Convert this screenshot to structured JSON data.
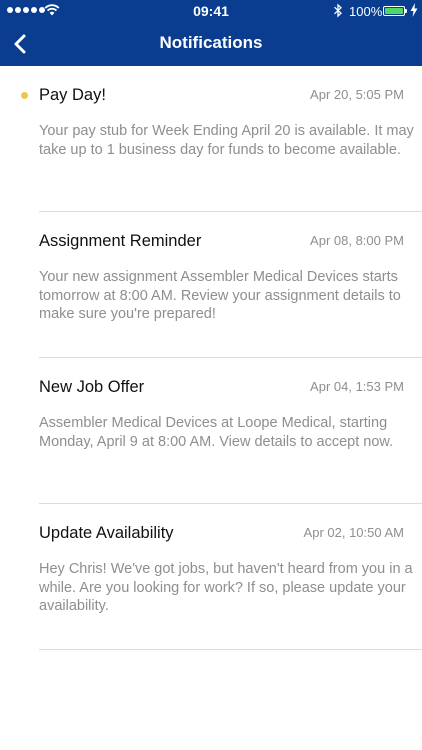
{
  "status_bar": {
    "time": "09:41",
    "battery_percent": "100%",
    "battery_level": 1.0,
    "icons": [
      "signal-dots",
      "wifi-icon",
      "bluetooth-icon",
      "battery-icon",
      "charging-bolt-icon"
    ]
  },
  "nav": {
    "title": "Notifications",
    "back_icon": "chevron-left-icon"
  },
  "colors": {
    "header_bg": "#0a3d8f",
    "unread_dot": "#f3c544",
    "battery_fill": "#4cd964",
    "body_text": "#8e8e93"
  },
  "notifications": [
    {
      "title": "Pay Day!",
      "date": "Apr 20, 5:05 PM",
      "body": "Your pay stub for Week Ending April 20 is available. It may take up to 1 business day for funds to become available.",
      "unread": true
    },
    {
      "title": "Assignment Reminder",
      "date": "Apr 08, 8:00 PM",
      "body": "Your new assignment Assembler Medical Devices starts tomorrow at 8:00 AM.  Review your assignment details to make sure you're prepared!",
      "unread": false
    },
    {
      "title": "New Job Offer",
      "date": "Apr 04, 1:53 PM",
      "body": "Assembler Medical Devices at Loope Medical, starting Monday, April 9 at 8:00 AM.  View details to accept now.",
      "unread": false
    },
    {
      "title": "Update Availability",
      "date": "Apr 02, 10:50 AM",
      "body": "Hey Chris!  We've got jobs, but haven't heard from you in a while.  Are you looking for work?  If so, please update your availability.",
      "unread": false
    }
  ]
}
